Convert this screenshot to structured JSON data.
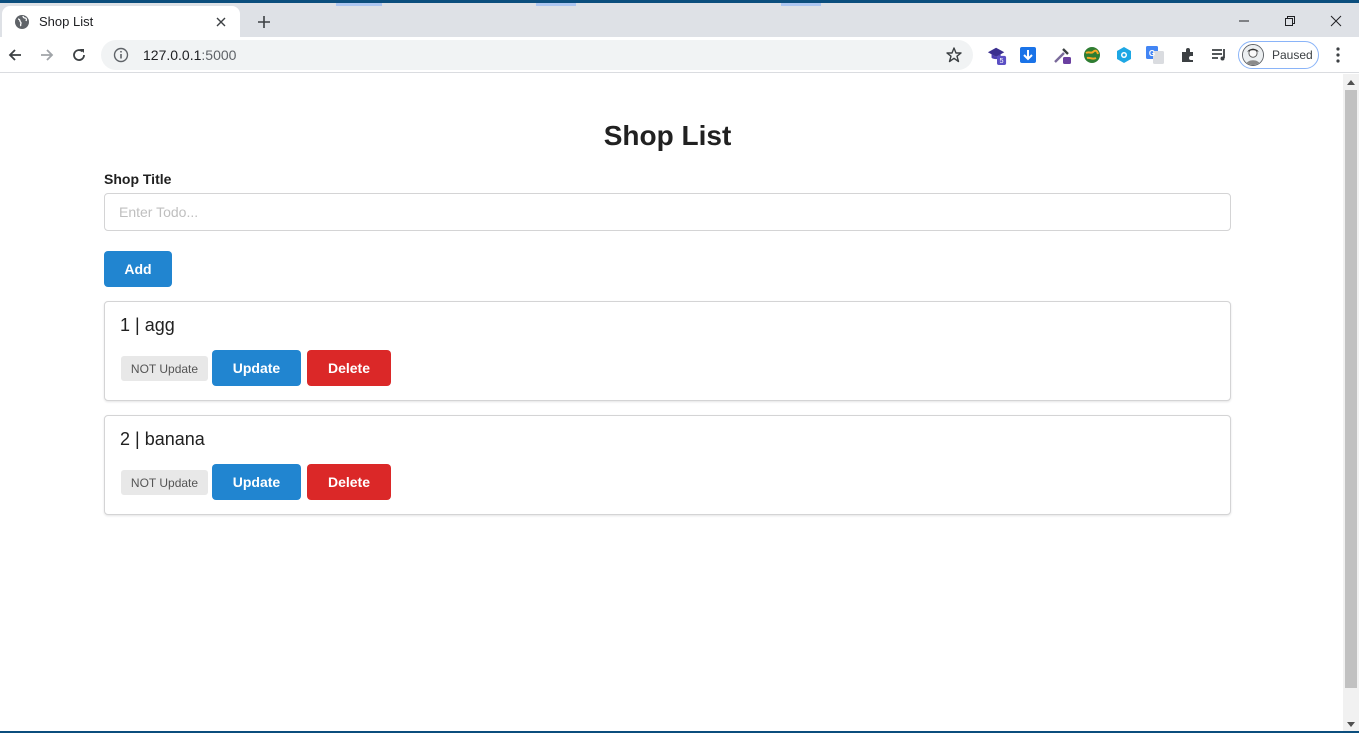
{
  "browser": {
    "tab_title": "Shop List",
    "url_host": "127.0.0.1",
    "url_port": ":5000",
    "profile_label": "Paused",
    "extension_badge": "5",
    "colors": {
      "frame": "#dee1e6",
      "accent": "#0b4e7d"
    }
  },
  "page": {
    "title": "Shop List",
    "field_label": "Shop Title",
    "input_placeholder": "Enter Todo...",
    "input_value": "",
    "add_label": "Add",
    "colors": {
      "primary": "#2185d0",
      "danger": "#db2828",
      "badge_bg": "#e8e8e8"
    }
  },
  "items": [
    {
      "heading": "1 | agg",
      "status": "NOT Update",
      "update_label": "Update",
      "delete_label": "Delete"
    },
    {
      "heading": "2 | banana",
      "status": "NOT Update",
      "update_label": "Update",
      "delete_label": "Delete"
    }
  ]
}
